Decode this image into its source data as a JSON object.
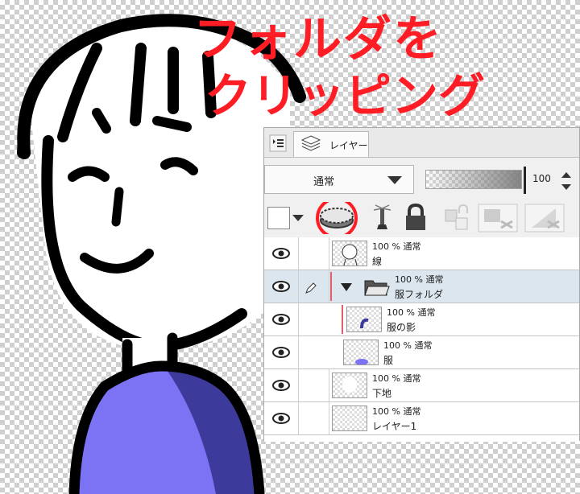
{
  "annotation": {
    "line1": "フォルダを",
    "line2": "クリッピング",
    "color": "#ff1d25"
  },
  "panel": {
    "tab_label": "レイヤー",
    "blend_mode": "通常",
    "opacity_value": "100",
    "opacity_level": 100,
    "toolbar": [
      "color-icon",
      "clip-to-lower-layer-icon",
      "reference-layer-icon",
      "lock-icon",
      "lock-transparency-icon",
      "mask-enable-icon",
      "show-mask-area-icon"
    ],
    "layers": [
      {
        "meta": "100 % 通常",
        "name": "線",
        "kind": "raster",
        "clipped": false,
        "selected": false
      },
      {
        "meta": "100 % 通常",
        "name": "服フォルダ",
        "kind": "folder",
        "clipped": true,
        "selected": true
      },
      {
        "meta": "100 % 通常",
        "name": "服の影",
        "kind": "raster",
        "clipped": true,
        "selected": false
      },
      {
        "meta": "100 % 通常",
        "name": "服",
        "kind": "raster",
        "clipped": false,
        "selected": false
      },
      {
        "meta": "100 % 通常",
        "name": "下地",
        "kind": "raster",
        "clipped": false,
        "selected": false
      },
      {
        "meta": "100 % 通常",
        "name": "レイヤー1",
        "kind": "raster",
        "clipped": false,
        "selected": false
      }
    ]
  },
  "colors": {
    "shirt": "#7b73f4",
    "shirt_shadow": "#3c3a9a",
    "annotation_red": "#ff1d25",
    "selected_row": "#dbe6ee"
  }
}
